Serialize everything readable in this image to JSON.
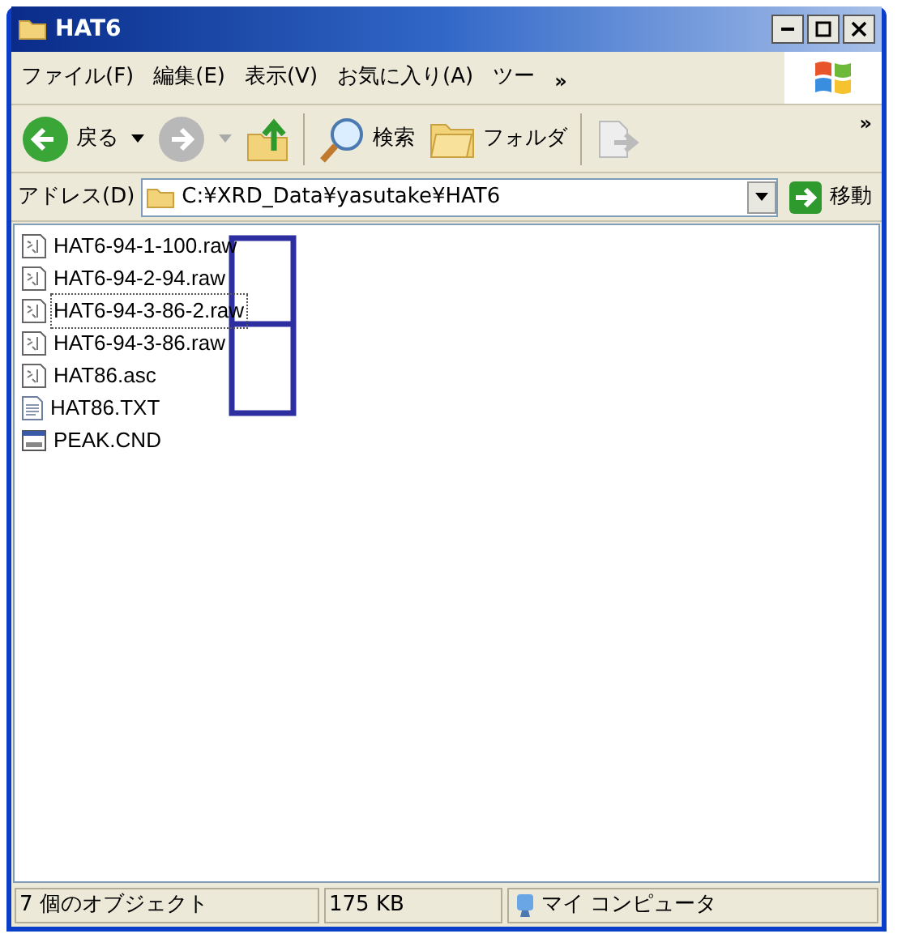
{
  "window": {
    "title": "HAT6"
  },
  "menu": [
    {
      "label": "ファイル(F)"
    },
    {
      "label": "編集(E)"
    },
    {
      "label": "表示(V)"
    },
    {
      "label": "お気に入り(A)"
    },
    {
      "label": "ツー"
    }
  ],
  "menu_overflow": "»",
  "toolbar": {
    "back": "戻る",
    "search": "検索",
    "folders": "フォルダ",
    "overflow": "»"
  },
  "address": {
    "label": "アドレス(D)",
    "value": "C:¥XRD_Data¥yasutake¥HAT6",
    "go": "移動"
  },
  "files": [
    {
      "name": "HAT6-94-1-100.raw",
      "kind": "data",
      "focused": false
    },
    {
      "name": "HAT6-94-2-94.raw",
      "kind": "data",
      "focused": false
    },
    {
      "name": "HAT6-94-3-86-2.raw",
      "kind": "data",
      "focused": true
    },
    {
      "name": "HAT6-94-3-86.raw",
      "kind": "data",
      "focused": false
    },
    {
      "name": "HAT86.asc",
      "kind": "data",
      "focused": false
    },
    {
      "name": "HAT86.TXT",
      "kind": "text",
      "focused": false
    },
    {
      "name": "PEAK.CND",
      "kind": "window",
      "focused": false
    }
  ],
  "status_bar": {
    "count": "7 個のオブジェクト",
    "size": "175 KB",
    "location": "マイ コンピュータ"
  }
}
